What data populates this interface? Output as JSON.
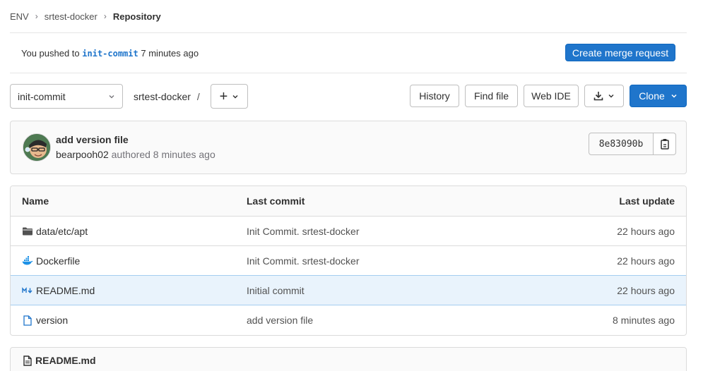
{
  "breadcrumb": {
    "items": [
      "ENV",
      "srtest-docker"
    ],
    "current": "Repository"
  },
  "push_banner": {
    "prefix": "You pushed to",
    "branch": "init-commit",
    "suffix": "7 minutes ago",
    "button": "Create merge request"
  },
  "toolbar": {
    "branch": "init-commit",
    "path": "srtest-docker",
    "path_sep": "/",
    "add_label": "+",
    "history": "History",
    "find_file": "Find file",
    "web_ide": "Web IDE",
    "clone": "Clone"
  },
  "commit": {
    "title": "add version file",
    "author": "bearpooh02",
    "meta": "authored 8 minutes ago",
    "sha": "8e83090b"
  },
  "tree": {
    "headers": {
      "name": "Name",
      "last_commit": "Last commit",
      "last_update": "Last update"
    },
    "rows": [
      {
        "name": "data/etc/apt",
        "icon": "folder-icon",
        "commit": "Init Commit. srtest-docker",
        "updated": "22 hours ago"
      },
      {
        "name": "Dockerfile",
        "icon": "docker-icon",
        "commit": "Init Commit. srtest-docker",
        "updated": "22 hours ago"
      },
      {
        "name": "README.md",
        "icon": "markdown-icon",
        "commit": "Initial commit",
        "updated": "22 hours ago"
      },
      {
        "name": "version",
        "icon": "file-icon",
        "commit": "add version file",
        "updated": "8 minutes ago"
      }
    ]
  },
  "readme": {
    "title": "README.md"
  },
  "colors": {
    "accent": "#1f75cb",
    "row_highlight": "#e9f3fc",
    "docker": "#1d91e6"
  }
}
